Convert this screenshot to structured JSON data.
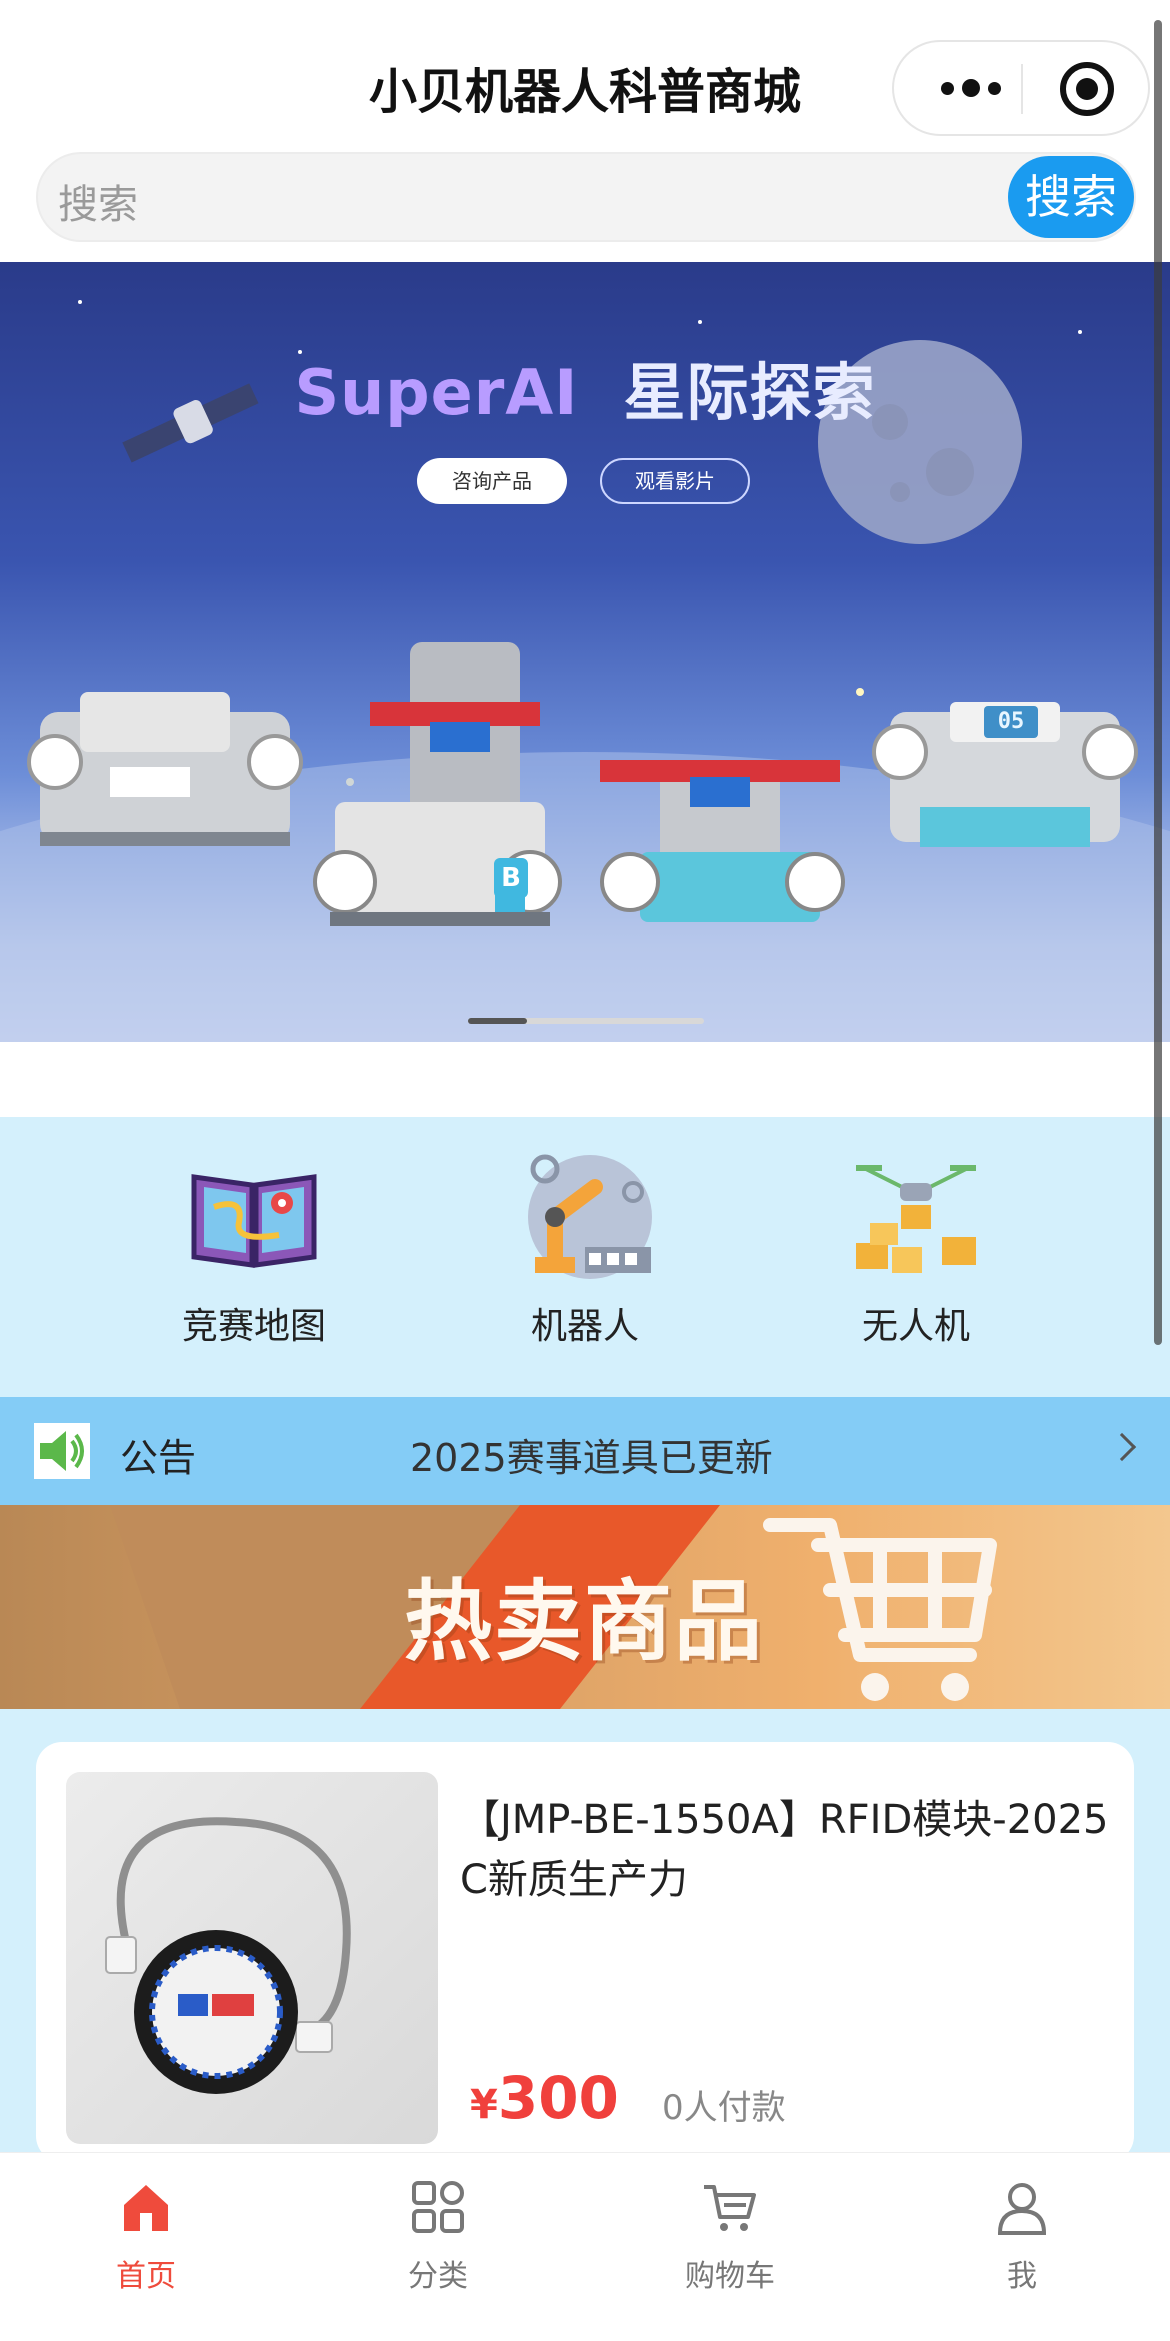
{
  "titlebar": {
    "title": "小贝机器人科普商城"
  },
  "search": {
    "placeholder": "搜索",
    "button_label": "搜索"
  },
  "banner": {
    "title_en": "SuperAI",
    "title_cn": "星际探索",
    "btn_consult": "咨询产品",
    "btn_watch": "观看影片",
    "robot_badge": "B",
    "robot_display": "05",
    "slide_progress": 0.25
  },
  "categories": [
    {
      "label": "竞赛地图",
      "icon": "map-book-icon"
    },
    {
      "label": "机器人",
      "icon": "robot-arm-icon"
    },
    {
      "label": "无人机",
      "icon": "drone-icon"
    }
  ],
  "notice": {
    "label": "公告",
    "text": "2025赛事道具已更新"
  },
  "hot_banner": {
    "title": "热卖商品"
  },
  "products": [
    {
      "title": "【JMP-BE-1550A】RFID模块-2025C新质生产力",
      "currency": "¥",
      "price": "300",
      "sold": "0人付款"
    }
  ],
  "tabbar": [
    {
      "label": "首页",
      "icon": "home-icon",
      "active": true
    },
    {
      "label": "分类",
      "icon": "category-icon",
      "active": false
    },
    {
      "label": "购物车",
      "icon": "cart-icon",
      "active": false
    },
    {
      "label": "我",
      "icon": "user-icon",
      "active": false
    }
  ],
  "colors": {
    "accent_blue": "#1a9bf0",
    "price_red": "#f0403c",
    "tab_active": "#ef4b3c",
    "page_bg": "#d4f0fc",
    "notice_bg": "#84ccf6"
  }
}
